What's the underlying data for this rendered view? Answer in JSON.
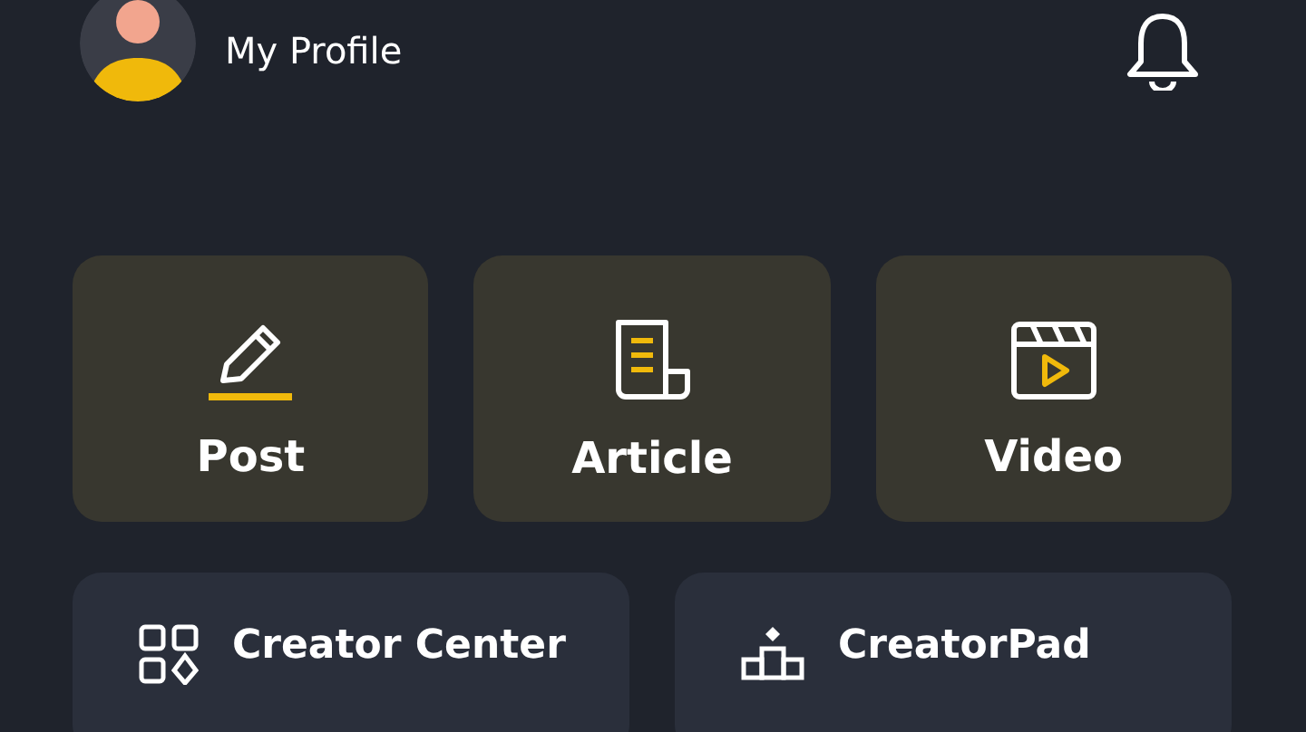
{
  "header": {
    "profile_label": "My Profile"
  },
  "actions": [
    {
      "label": "Post",
      "kind": "post"
    },
    {
      "label": "Article",
      "kind": "article"
    },
    {
      "label": "Video",
      "kind": "video"
    }
  ],
  "tools": [
    {
      "label": "Creator Center",
      "kind": "center"
    },
    {
      "label": "CreatorPad",
      "kind": "pad"
    }
  ]
}
